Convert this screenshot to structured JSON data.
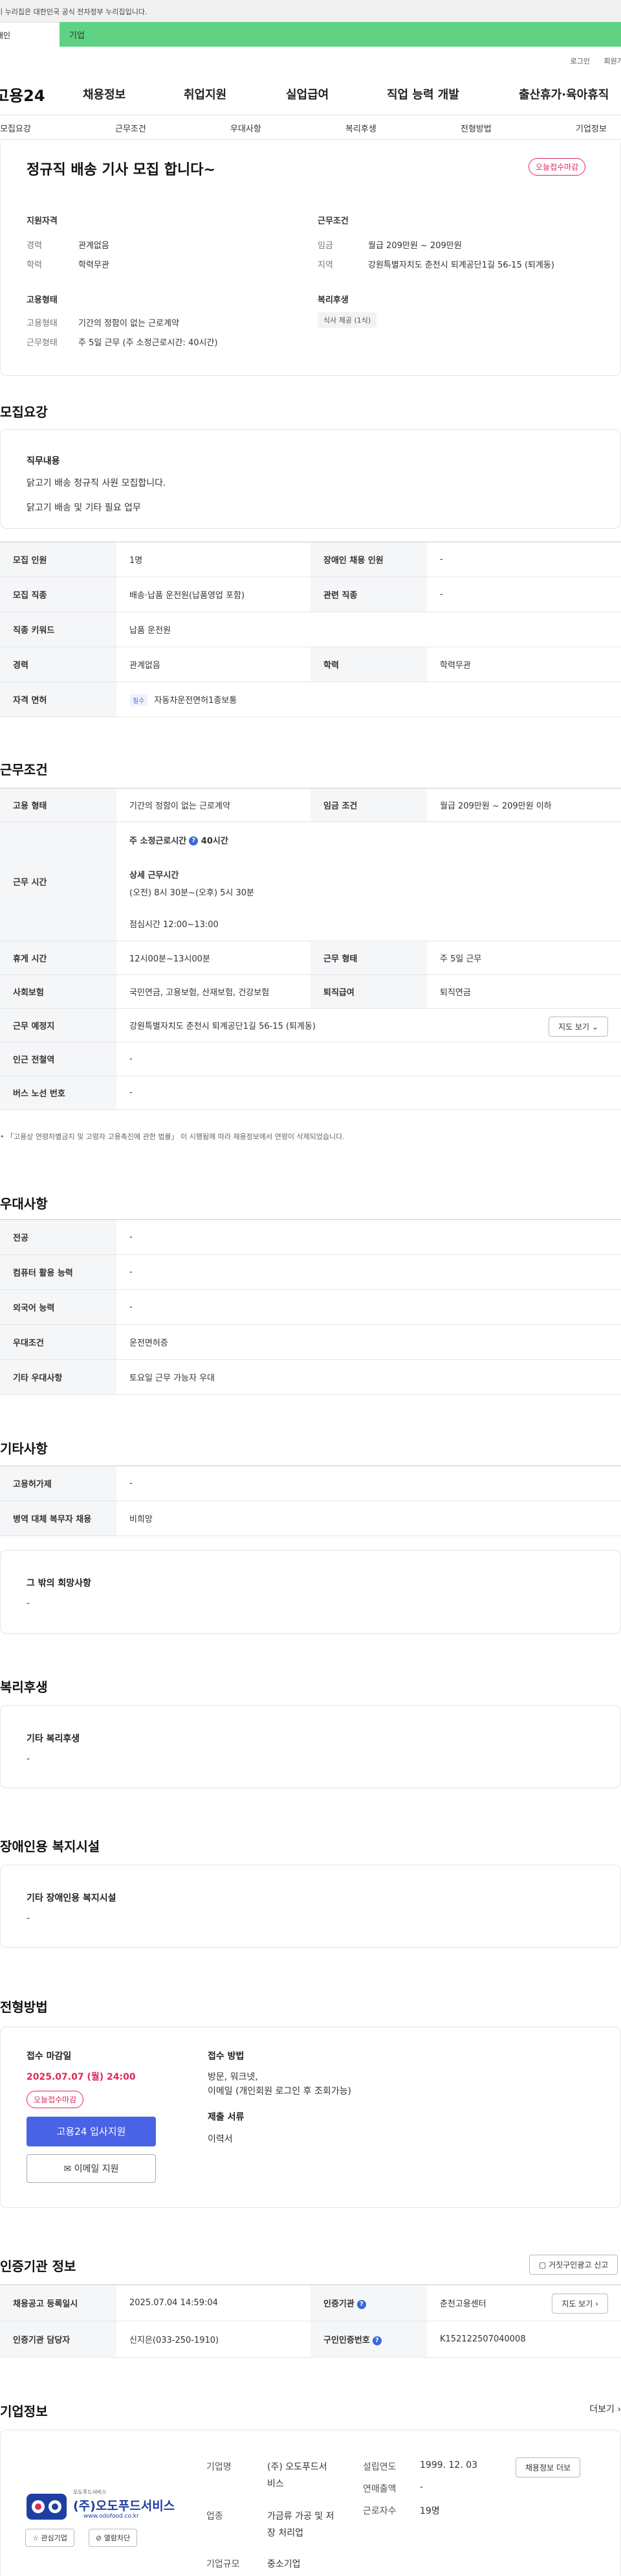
{
  "gov_notice": "이 누리집은 대한민국 공식 전자정부 누리집입니다.",
  "tabs": {
    "person": "개인",
    "corp": "기업"
  },
  "util": {
    "login": "로그인",
    "signup": "회원가입"
  },
  "logo": "고용24",
  "gnb": [
    "채용정보",
    "취업지원",
    "실업급여",
    "직업 능력 개발",
    "출산휴가·육아휴직"
  ],
  "subnav": [
    "모집요강",
    "근무조건",
    "우대사항",
    "복리후생",
    "전형방법",
    "기업정보"
  ],
  "summary": {
    "title": "정규직 배송 기사 모집 합니다~",
    "badge": "오늘접수마감",
    "qual_head": "지원자격",
    "career_k": "경력",
    "career_v": "관계없음",
    "edu_k": "학력",
    "edu_v": "학력무관",
    "emp_head": "고용형태",
    "emp_k": "고용형태",
    "emp_v": "기간의 정함이 없는 근로계약",
    "work_k": "근무형태",
    "work_v": "주 5일 근무 (주 소정근로시간: 40시간)",
    "cond_head": "근무조건",
    "wage_k": "임금",
    "wage_v": "월급 209만원 ~ 209만원",
    "area_k": "지역",
    "area_v": "강원특별자치도 춘천시 퇴계공단1길 56-15 (퇴계동)",
    "welfare_head": "복리후생",
    "welfare_chip": "식사 제공 (1식)"
  },
  "recruit": {
    "title": "모집요강",
    "duty_head": "직무내용",
    "duty_line1": "닭고기 배송 정규직 사원 모집합니다.",
    "duty_line2": "닭고기 배송 및 기타 필요 업무",
    "rows": {
      "count_k": "모집 인원",
      "count_v": "1명",
      "disabled_k": "장애인 채용 인원",
      "disabled_v": "-",
      "job_k": "모집 직종",
      "job_v": "배송·납품 운전원(납품영업 포함)",
      "rel_k": "관련 직종",
      "rel_v": "-",
      "keyword_k": "직종 키워드",
      "keyword_v": "납품 운전원",
      "career_k": "경력",
      "career_v": "관계없음",
      "edu_k": "학력",
      "edu_v": "학력무관",
      "license_k": "자격 면허",
      "license_chip": "필수",
      "license_v": "자동차운전면허1종보통"
    }
  },
  "conditions": {
    "title": "근무조건",
    "emp_k": "고용 형태",
    "emp_v": "기간의 정함이 없는 근로계약",
    "wage_k": "임금 조건",
    "wage_v": "월급 209만원 ~ 209만원 이하",
    "time_k": "근무 시간",
    "time_line1": "주 소정근로시간",
    "time_hours": "40시간",
    "time_line2": "상세 근무시간",
    "time_line3": "(오전) 8시 30분~(오후) 5시 30분",
    "time_line4": "점심시간 12:00~13:00",
    "rest_k": "휴게 시간",
    "rest_v": "12시00분~13시00분",
    "form_k": "근무 형태",
    "form_v": "주 5일 근무",
    "ins_k": "사회보험",
    "ins_v": "국민연금, 고용보험, 산재보험, 건강보험",
    "ret_k": "퇴직급여",
    "ret_v": "퇴직연금",
    "place_k": "근무 예정지",
    "place_v": "강원특별자치도 춘천시 퇴계공단1길 56-15 (퇴계동)",
    "map_btn": "지도 보기",
    "station_k": "인근 전철역",
    "station_v": "-",
    "bus_k": "버스 노선 번호",
    "bus_v": "-",
    "note": "「고용상 연령차별금지 및 고령자 고용촉진에 관한 법률」 이 시행됨에 따라 채용정보에서 연령이 삭제되었습니다."
  },
  "preference": {
    "title": "우대사항",
    "major_k": "전공",
    "major_v": "-",
    "pc_k": "컴퓨터 활용 능력",
    "pc_v": "-",
    "lang_k": "외국어 능력",
    "lang_v": "-",
    "pref_k": "우대조건",
    "pref_v": "운전면허증",
    "etc_k": "기타 우대사항",
    "etc_v": "토요일 근무 가능자 우대"
  },
  "etc": {
    "title": "기타사항",
    "foreign_k": "고용허가제",
    "foreign_v": "-",
    "military_k": "병역 대체 복무자 채용",
    "military_v": "비희망",
    "wish_head": "그 밖의 희망사항",
    "wish_v": "-"
  },
  "welfare": {
    "title": "복리후생",
    "head": "기타 복리후생",
    "v": "-"
  },
  "disability": {
    "title": "장애인용 복지시설",
    "head": "기타 장애인용 복지시설",
    "v": "-"
  },
  "process": {
    "title": "전형방법",
    "deadline_head": "접수 마감일",
    "deadline": "2025.07.07 (월) 24:00",
    "badge": "오늘접수마감",
    "apply_btn": "고용24 입사지원",
    "mail_btn": "이메일 지원",
    "method_head": "접수 방법",
    "method_v1": "방문, 워크넷,",
    "method_v2": "이메일 (개인회원 로그인 후 조회가능)",
    "docs_head": "제출 서류",
    "docs_v": "이력서"
  },
  "agency": {
    "title": "인증기관 정보",
    "report_btn": "거짓구인광고 신고",
    "reg_k": "채용공고 등록일시",
    "reg_v": "2025.07.04 14:59:04",
    "org_k": "인증기관",
    "org_v": "춘천고용센터",
    "map_btn": "지도 보기",
    "mgr_k": "인증기관 담당자",
    "mgr_v": "신지은(033-250-1910)",
    "num_k": "구인인증번호",
    "num_v": "K152122507040008"
  },
  "company": {
    "title": "기업정보",
    "more": "더보기",
    "logo_small": "오도푸드서비스",
    "logo_main": "(주)오도푸드서비스",
    "logo_url": "www.odofood.co.kr",
    "fav_btn": "관심기업",
    "block_btn": "열람차단",
    "name_k": "기업명",
    "name_v1": "(주) 오도푸드서",
    "name_v2": "비스",
    "biz_k": "업종",
    "biz_v1": "가금류 가공 및 저",
    "biz_v2": "장 처리업",
    "size_k": "기업규모",
    "size_v": "중소기업",
    "est_k": "설립연도",
    "est_v": "1999. 12. 03",
    "sales_k": "연매출액",
    "sales_v": "-",
    "emp_k": "근로자수",
    "emp_v": "19명",
    "info_btn": "채용정보 더보",
    "colors": {
      "accent_red": "#e0285a",
      "brand_blue": "#4a63e6",
      "corp_green": "#5fd283"
    }
  }
}
